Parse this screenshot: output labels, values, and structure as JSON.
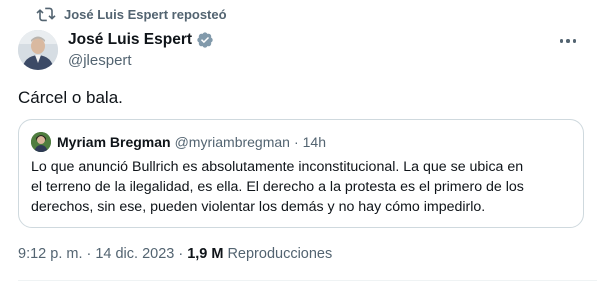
{
  "repost": {
    "label": "José Luis Espert reposteó",
    "icon": "repost-icon"
  },
  "author": {
    "display_name": "José Luis Espert",
    "handle": "@jlespert",
    "verified": true,
    "verified_color": "#1d9bf0"
  },
  "tweet": {
    "text": "Cárcel o bala."
  },
  "quote": {
    "display_name": "Myriam Bregman",
    "handle": "@myriambregman",
    "separator": "·",
    "time": "14h",
    "lines": [
      "Lo que anunció Bullrich es absolutamente inconstitucional. La que se ubica en",
      "el terreno de la ilegalidad, es ella. El derecho a la protesta es el primero de los",
      "derechos,  sin ese, pueden violentar los demás y no hay cómo impedirlo."
    ]
  },
  "meta": {
    "timestamp": "9:12 p. m.",
    "separator1": "·",
    "date": "14 dic. 2023",
    "separator2": "·",
    "views_count": "1,9 M",
    "views_label": "Reproducciones"
  },
  "colors": {
    "text_primary": "#0f1419",
    "text_secondary": "#536471",
    "border": "#cfd9de"
  }
}
